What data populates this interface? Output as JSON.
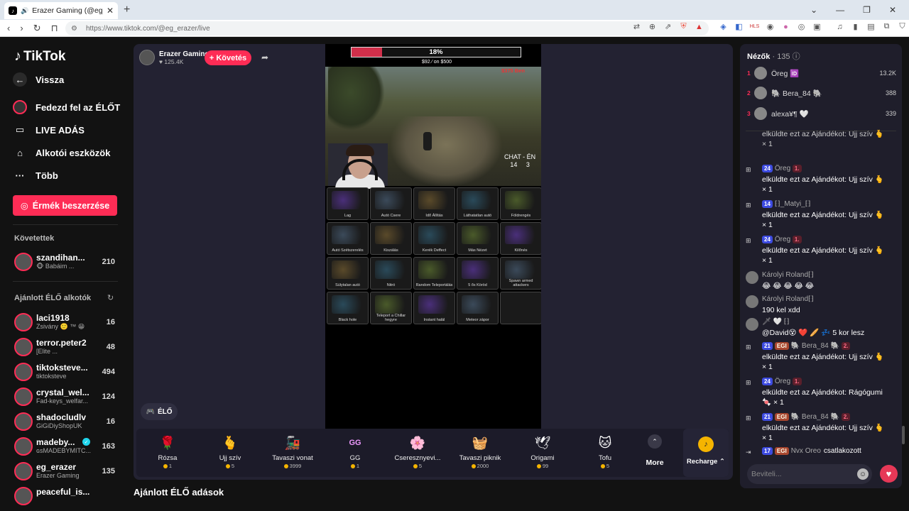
{
  "browser": {
    "tab_title": "Erazer Gaming (@eg_erazer) i",
    "url": "https://www.tiktok.com/@eg_erazer/live",
    "new_tab": "+",
    "close": "✕"
  },
  "sidebar": {
    "logo": "TikTok",
    "nav": [
      {
        "label": "Vissza"
      },
      {
        "label": "Fedezd fel az ÉLŐT"
      },
      {
        "label": "LIVE ADÁS"
      },
      {
        "label": "Alkotói eszközök"
      },
      {
        "label": "Több"
      }
    ],
    "buy_coins": "Érmék beszerzése",
    "following_title": "Követettek",
    "following": [
      {
        "name": "szandihan...",
        "sub": "🐵 Babáim ...",
        "count": "210"
      }
    ],
    "recommended_title": "Ajánlott ÉLŐ alkotók",
    "recommended": [
      {
        "name": "laci1918",
        "sub": "Zsivány 🙂 ™ 😁",
        "count": "16"
      },
      {
        "name": "terror.peter2",
        "sub": "[Elite ...",
        "count": "48"
      },
      {
        "name": "tiktoksteve...",
        "sub": "tiktoksteve",
        "count": "494"
      },
      {
        "name": "crystal_wel...",
        "sub": "Fad-keys_welfar...",
        "count": "124"
      },
      {
        "name": "shadocludlv",
        "sub": "GiGiDiyShopUK",
        "count": "16"
      },
      {
        "name": "madeby...",
        "sub": "ɢsMADEBYMITC...",
        "count": "163"
      },
      {
        "name": "eg_erazer",
        "sub": "Erazer Gaming",
        "count": "135"
      },
      {
        "name": "peaceful_is...",
        "sub": "",
        "count": ""
      }
    ]
  },
  "stream": {
    "host_name": "Erazer Gaming",
    "likes": "125.4K",
    "follow": "+ Követés",
    "progress_label": "18%",
    "progress": 0.18,
    "goal_text": "$92 ⁄ on $500",
    "balance": "$375 Ben",
    "chat_vote": "CHAT - ÉN",
    "vote_a": "14",
    "vote_b": "3",
    "grid": [
      [
        "Lag",
        "Autó Csere",
        "Idő Állítás",
        "Láthatatlan autó",
        "Földrengés"
      ],
      [
        "Autó Szétszerelés",
        "Kiszálás",
        "Kerék Deffect",
        "Más Nézet",
        "Kilőnés"
      ],
      [
        "Súlytalan autó",
        "Nitró",
        "Random Teleportálás",
        "5 ős Köröd",
        "Spawn armed attackers"
      ],
      [
        "Black hole",
        "Teleport a Chillar hegyre",
        "Instant halál",
        "Meteor zápor",
        ""
      ]
    ],
    "elo_label": "ÉLŐ"
  },
  "gifts": [
    {
      "name": "Rózsa",
      "price": "1",
      "icon": "🌹"
    },
    {
      "name": "Ujj szív",
      "price": "5",
      "icon": "🫰"
    },
    {
      "name": "Tavaszi vonat",
      "price": "3999",
      "icon": "🚂"
    },
    {
      "name": "GG",
      "price": "1",
      "icon": "GG"
    },
    {
      "name": "Cseresznyevi...",
      "price": "5",
      "icon": "🌸"
    },
    {
      "name": "Tavaszi piknik",
      "price": "2000",
      "icon": "🧺"
    },
    {
      "name": "Origami",
      "price": "99",
      "icon": "🕊"
    },
    {
      "name": "Tofu",
      "price": "5",
      "icon": "🐱"
    }
  ],
  "more_label": "More",
  "recharge_label": "Recharge ⌃",
  "recommended_live": "Ajánlott ÉLŐ adások",
  "chat": {
    "title": "Nézők",
    "viewer_count": "· 135",
    "top": [
      {
        "rank": "1",
        "name": "Öreg 🆔",
        "score": "13.2K"
      },
      {
        "rank": "2",
        "name": "🐘 Bera_84 🐘",
        "score": "388"
      },
      {
        "rank": "3",
        "name": "alexa¥¶ 🤍",
        "score": "339"
      }
    ],
    "messages": [
      {
        "kind": "gift",
        "head": "",
        "text": "elküldte ezt az Ajándékot: Ujj szív 🫰",
        "qty": "× 1"
      },
      {
        "kind": "gift",
        "head": "Öreg",
        "lvl": "24",
        "rank": "1.",
        "text": "elküldte ezt az Ajándékot: Ujj szív 🫰",
        "qty": "× 1"
      },
      {
        "kind": "gift",
        "head": "⁅⁆_Matyi_⁅⁆",
        "lvl": "14",
        "text": "elküldte ezt az Ajándékot: Ujj szív 🫰",
        "qty": "× 1"
      },
      {
        "kind": "gift",
        "head": "Öreg",
        "lvl": "24",
        "rank": "1.",
        "text": "elküldte ezt az Ajándékot: Ujj szív 🫰",
        "qty": "× 1"
      },
      {
        "kind": "chat",
        "head": "Károlyi Roland⁅⁆",
        "text": "😂 😂 😂 😂 😂"
      },
      {
        "kind": "chat",
        "head": "Károlyi Roland⁅⁆",
        "text": "190 kel xdd"
      },
      {
        "kind": "chat",
        "head": "🗡 🤍 ⁅⁆",
        "text": "@David😵 ❤️ 🥖 💤 5 kor lesz"
      },
      {
        "kind": "gift",
        "head": "🐘 Bera_84 🐘",
        "lvl": "21",
        "gold": "EGI",
        "rank": "2.",
        "text": "elküldte ezt az Ajándékot: Ujj szív 🫰",
        "qty": "× 1"
      },
      {
        "kind": "gift",
        "head": "Öreg",
        "lvl": "24",
        "rank": "1.",
        "text": "elküldte ezt az Ajándékot: Rágógumi",
        "qty": "🍬 × 1"
      },
      {
        "kind": "gift",
        "head": "🐘 Bera_84 🐘",
        "lvl": "21",
        "gold": "EGI",
        "rank": "2.",
        "text": "elküldte ezt az Ajándékot: Ujj szív 🫰",
        "qty": "× 1"
      },
      {
        "kind": "join",
        "head": "Nvx Oreo",
        "lvl": "17",
        "gold": "EGI",
        "text": "csatlakozott"
      }
    ],
    "input_placeholder": "Beviteli..."
  }
}
